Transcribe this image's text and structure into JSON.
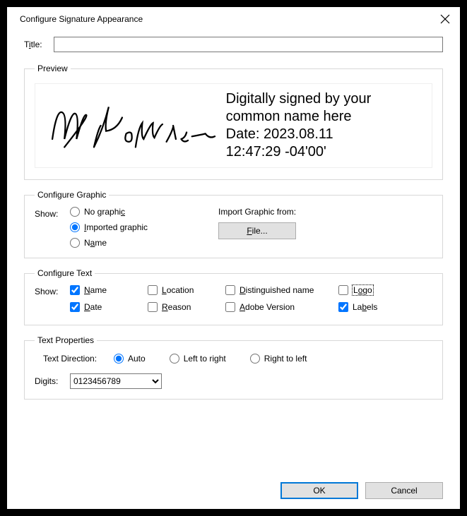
{
  "dialog": {
    "title": "Configure Signature Appearance",
    "close_icon": "close-icon"
  },
  "titleField": {
    "label_prefix": "T",
    "label_underline": "i",
    "label_suffix": "tle:",
    "value": ""
  },
  "preview": {
    "legend": "Preview",
    "graphicAlt": "My Signature (handwritten)",
    "textLine1": "Digitally signed by your",
    "textLine2": "common name here",
    "textLine3": "Date: 2023.08.11",
    "textLine4": "12:47:29 -04'00'"
  },
  "configureGraphic": {
    "legend": "Configure Graphic",
    "showLabel": "Show:",
    "options": {
      "noGraphic": {
        "prefix": "No graphi",
        "underline": "c",
        "suffix": "",
        "selected": false
      },
      "imported": {
        "underline": "I",
        "suffix": "mported graphic",
        "selected": true
      },
      "name": {
        "prefix": "N",
        "underline": "a",
        "suffix": "me",
        "selected": false
      }
    },
    "importLabel": "Import Graphic from:",
    "fileButton": {
      "underline": "F",
      "suffix": "ile..."
    }
  },
  "configureText": {
    "legend": "Configure Text",
    "showLabel": "Show:",
    "checks": {
      "name": {
        "underline": "N",
        "suffix": "ame",
        "checked": true
      },
      "location": {
        "underline": "L",
        "suffix": "ocation",
        "checked": false
      },
      "dname": {
        "underline": "D",
        "suffix": "istinguished name",
        "checked": false
      },
      "logo": {
        "prefix": "L",
        "underline": "o",
        "suffix": "go",
        "checked": false,
        "focus": true
      },
      "date": {
        "underline": "D",
        "suffix": "ate",
        "checked": true
      },
      "reason": {
        "underline": "R",
        "suffix": "eason",
        "checked": false
      },
      "adobe": {
        "underline": "A",
        "suffix": "dobe Version",
        "checked": false
      },
      "labels": {
        "prefix": "La",
        "underline": "b",
        "suffix": "els",
        "checked": true
      }
    }
  },
  "textProperties": {
    "legend": "Text Properties",
    "directionLabel": "Text Direction:",
    "radios": {
      "auto": {
        "label": "Auto",
        "selected": true
      },
      "ltr": {
        "label": "Left to right",
        "selected": false
      },
      "rtl": {
        "label": "Right to left",
        "selected": false
      }
    },
    "digitsLabel": "Digits:",
    "digitsValue": "0123456789"
  },
  "footer": {
    "ok": "OK",
    "cancel": "Cancel"
  }
}
